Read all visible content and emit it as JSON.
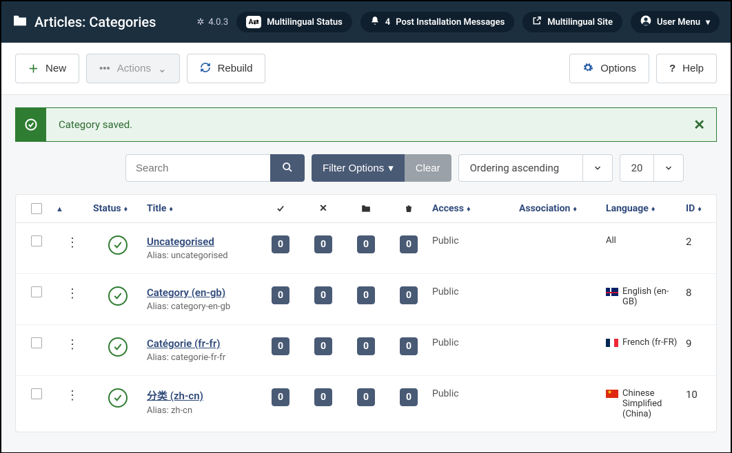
{
  "topbar": {
    "title": "Articles: Categories",
    "version": "4.0.3",
    "multilingual_status": "Multilingual Status",
    "messages_count": "4",
    "messages_label": "Post Installation Messages",
    "multilingual_site": "Multilingual Site",
    "user_menu": "User Menu"
  },
  "toolbar": {
    "new_label": "New",
    "actions_label": "Actions",
    "rebuild_label": "Rebuild",
    "options_label": "Options",
    "help_label": "Help"
  },
  "alert": {
    "text": "Category saved."
  },
  "filters": {
    "search_placeholder": "Search",
    "filter_options": "Filter Options",
    "clear": "Clear",
    "ordering": "Ordering ascending",
    "limit": "20"
  },
  "columns": {
    "status": "Status",
    "title": "Title",
    "access": "Access",
    "association": "Association",
    "language": "Language",
    "id": "ID"
  },
  "rows": [
    {
      "title": "Uncategorised",
      "alias": "Alias: uncategorised",
      "counts": [
        "0",
        "0",
        "0",
        "0"
      ],
      "access": "Public",
      "language": "All",
      "flag": "",
      "id": "2"
    },
    {
      "title": "Category (en-gb)",
      "alias": "Alias: category-en-gb",
      "counts": [
        "0",
        "0",
        "0",
        "0"
      ],
      "access": "Public",
      "language": "English (en-GB)",
      "flag": "gb",
      "id": "8"
    },
    {
      "title": "Catégorie (fr-fr)",
      "alias": "Alias: categorie-fr-fr",
      "counts": [
        "0",
        "0",
        "0",
        "0"
      ],
      "access": "Public",
      "language": "French (fr-FR)",
      "flag": "fr",
      "id": "9"
    },
    {
      "title": "分类 (zh-cn)",
      "alias": "Alias: zh-cn",
      "counts": [
        "0",
        "0",
        "0",
        "0"
      ],
      "access": "Public",
      "language": "Chinese Simplified (China)",
      "flag": "cn",
      "id": "10"
    }
  ]
}
